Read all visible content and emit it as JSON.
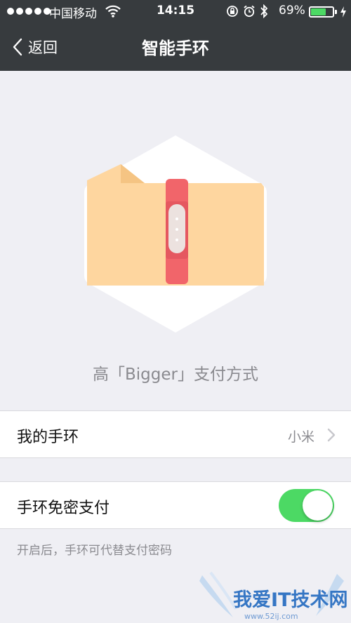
{
  "status_bar": {
    "carrier": "中国移动",
    "time": "14:15",
    "battery_percent": "69%",
    "battery_level": 0.69,
    "battery_color": "#4cd964"
  },
  "nav": {
    "back_label": "返回",
    "title": "智能手环"
  },
  "illustration": {
    "icon": "wristband-icon",
    "caption": "高「Bigger」支付方式"
  },
  "list": {
    "my_band": {
      "label": "我的手环",
      "value": "小米"
    },
    "password_free": {
      "label": "手环免密支付",
      "enabled": true
    },
    "hint": "开启后，手环可代替支付密码"
  },
  "watermark": {
    "text": "我爱IT技术网",
    "url": "www.52ij.com"
  },
  "colors": {
    "header_bg": "#373b3e",
    "page_bg": "#efeff4",
    "toggle_on": "#4cd964",
    "band_red": "#f1656a",
    "folder_orange": "#fed69f"
  }
}
